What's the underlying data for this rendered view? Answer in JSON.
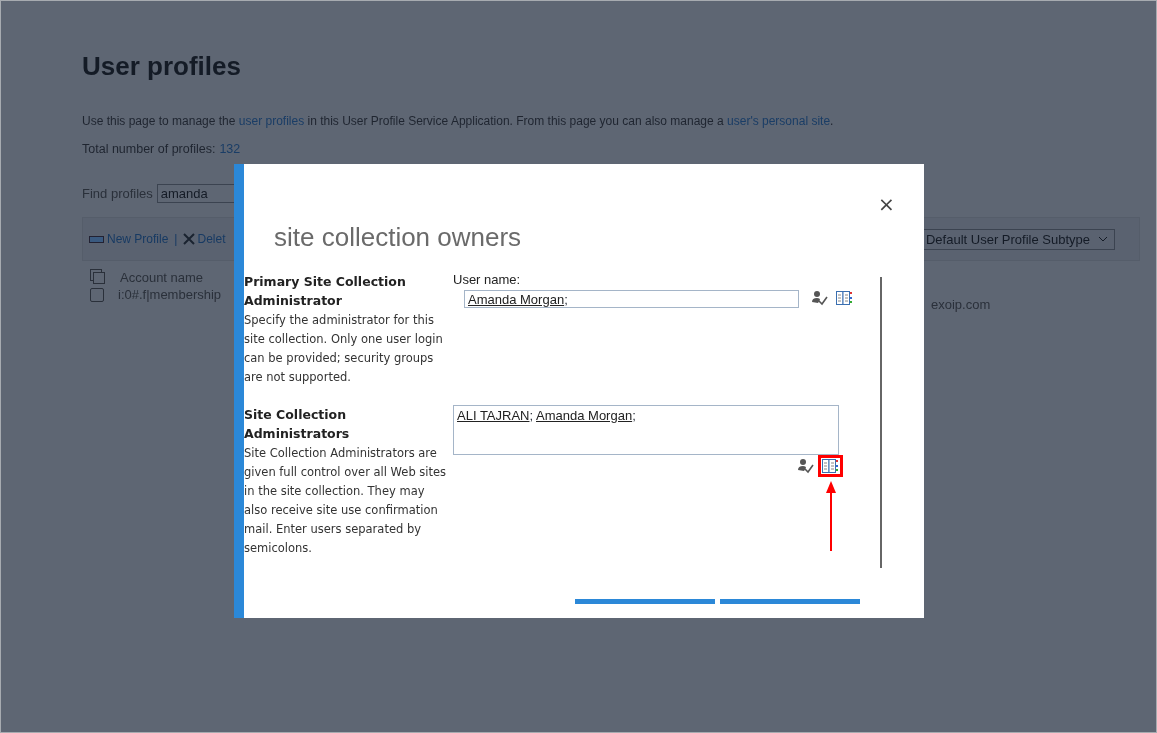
{
  "page": {
    "title": "User profiles",
    "description": {
      "text_1": "Use this page to manage the ",
      "link_1": "user profiles",
      "text_2": " in this User Profile Service Application. From this page you can also manage a ",
      "link_2": "user's personal site",
      "text_3": "."
    },
    "total_label": "Total number of profiles:",
    "total_value": "132",
    "find_label": "Find profiles",
    "find_value": "amanda",
    "toolbar_separator": "|",
    "toolbar": [
      {
        "label": "New Profile",
        "kind": "new"
      },
      {
        "label": "Delet",
        "kind": "delete"
      }
    ],
    "subtype_dropdown": "Default User Profile Subtype",
    "table": {
      "columns": [
        "Account name"
      ],
      "rows": [
        {
          "account": "i:0#.f|membership",
          "column_2": "exoip.com",
          "checked": false
        }
      ]
    }
  },
  "dialog": {
    "title": "site collection owners",
    "close": "×",
    "sections": [
      {
        "heading": "Primary Site Collection Administrator",
        "description": "Specify the administrator for this site collection. Only one user login can be provided; security groups are not supported.",
        "kind": "single",
        "field_label": "User name:",
        "separator": ";",
        "users": [
          "Amanda Morgan"
        ],
        "highlighted": false
      },
      {
        "heading": "Site Collection Administrators",
        "description": "Site Collection Administrators are given full control over all Web sites in the site collection. They may also receive site use confirmation mail. Enter users separated by semicolons.",
        "kind": "multi",
        "separator": ";",
        "users": [
          "ALI TAJRAN",
          "Amanda Morgan"
        ],
        "highlighted": true
      }
    ]
  }
}
